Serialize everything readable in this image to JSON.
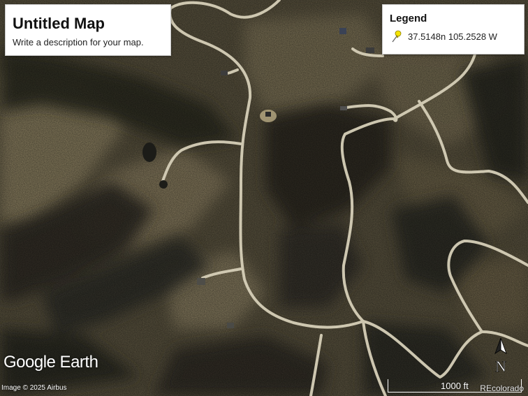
{
  "map": {
    "title": "Untitled Map",
    "description": "Write a description for your map."
  },
  "legend": {
    "title": "Legend",
    "items": [
      {
        "icon": "yellow-pushpin-icon",
        "label": "37.5148n 105.2528 W",
        "color": "#f5e400"
      }
    ]
  },
  "branding": {
    "watermark": "Google Earth",
    "attribution": "Image © 2025 Airbus",
    "provider": "REcolorado"
  },
  "scale": {
    "label": "1000 ft"
  },
  "compass": {
    "label": "N"
  },
  "colors": {
    "road": "#d6cfb8",
    "forest": "#3a3a2c",
    "grassland": "#8f8363"
  }
}
